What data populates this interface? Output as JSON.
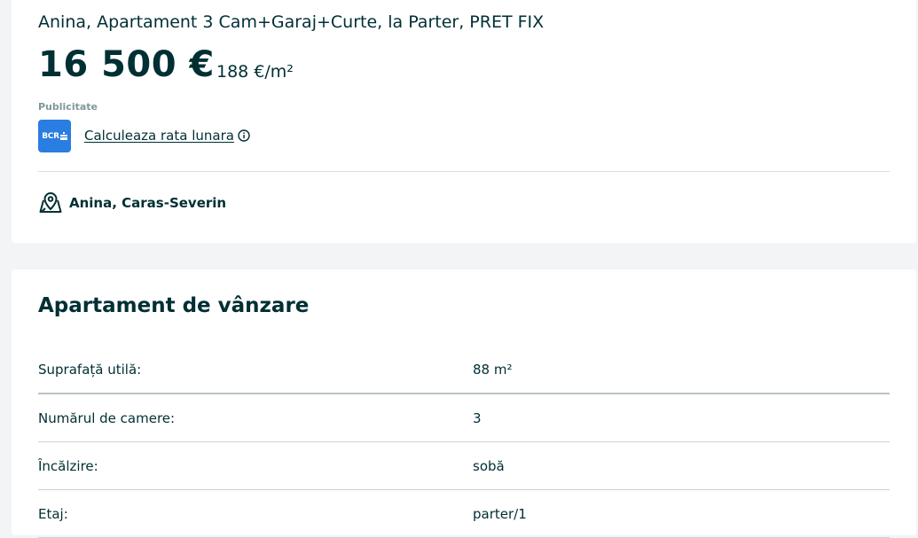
{
  "listing": {
    "title": "Anina, Apartament 3 Cam+Garaj+Curte, la Parter, PRET FIX",
    "price": "16 500 €",
    "price_per_sqm": "188 €/m²",
    "ad_label": "Publicitate",
    "bank_logo_text": "BCR",
    "calc_link": "Calculeaza rata lunara",
    "location": "Anina, Caras-Severin"
  },
  "details": {
    "section_title": "Apartament de vânzare",
    "rows": [
      {
        "label": "Suprafață utilă:",
        "value": "88 m²"
      },
      {
        "label": "Numărul de camere:",
        "value": "3"
      },
      {
        "label": "Încălzire:",
        "value": "sobă"
      },
      {
        "label": "Etaj:",
        "value": "parter/1"
      }
    ]
  },
  "colors": {
    "text": "#002f34",
    "muted": "#7f9799",
    "bank_blue": "#2a7de1",
    "background": "#f2f4f5"
  },
  "icons": {
    "bank": "bcr-logo-icon",
    "info": "info-icon",
    "location": "map-pin-icon"
  }
}
